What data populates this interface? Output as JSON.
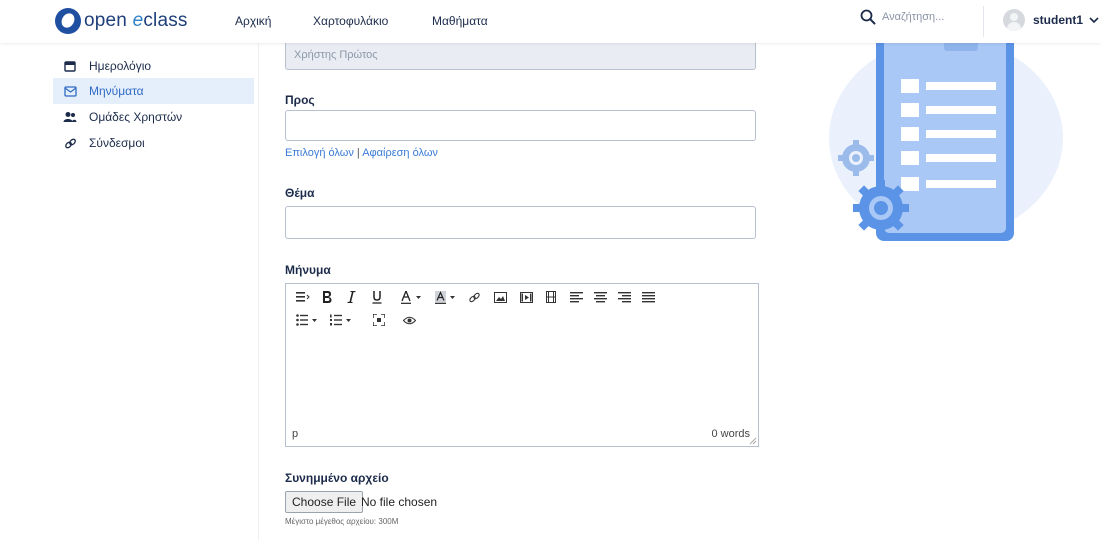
{
  "header": {
    "logo_text_open": "open",
    "logo_text_e": "e",
    "logo_text_class": "class",
    "nav": [
      "Αρχική",
      "Χαρτοφυλάκιο",
      "Μαθήματα"
    ],
    "search_placeholder": "Αναζήτηση...",
    "username": "student1"
  },
  "sidebar": {
    "items": [
      {
        "label": "Ημερολόγιο",
        "icon": "calendar-icon",
        "active": false
      },
      {
        "label": "Μηνύματα",
        "icon": "envelope-icon",
        "active": true
      },
      {
        "label": "Ομάδες Χρηστών",
        "icon": "users-icon",
        "active": false
      },
      {
        "label": "Σύνδεσμοι",
        "icon": "link-icon",
        "active": false
      }
    ]
  },
  "form": {
    "sender_value": "Χρήστης Πρώτος",
    "to_label": "Προς",
    "to_value": "",
    "select_all": "Επιλογή όλων",
    "link_separator": "|",
    "deselect_all": "Αφαίρεση όλων",
    "subject_label": "Θέμα",
    "subject_value": "",
    "message_label": "Μήνυμα",
    "editor_path": "p",
    "editor_wordcount": "0 words",
    "attachment_label": "Συνημμένο αρχείο",
    "choose_file": "Choose File",
    "no_file": "No file chosen",
    "max_size_hint": "Μέγιστο μέγεθος αρχείου: 300M"
  },
  "colors": {
    "accent": "#2f6bc4",
    "link": "#3a7bd5",
    "active_bg": "#e5effc",
    "illustration_blue": "#5b93e6"
  }
}
